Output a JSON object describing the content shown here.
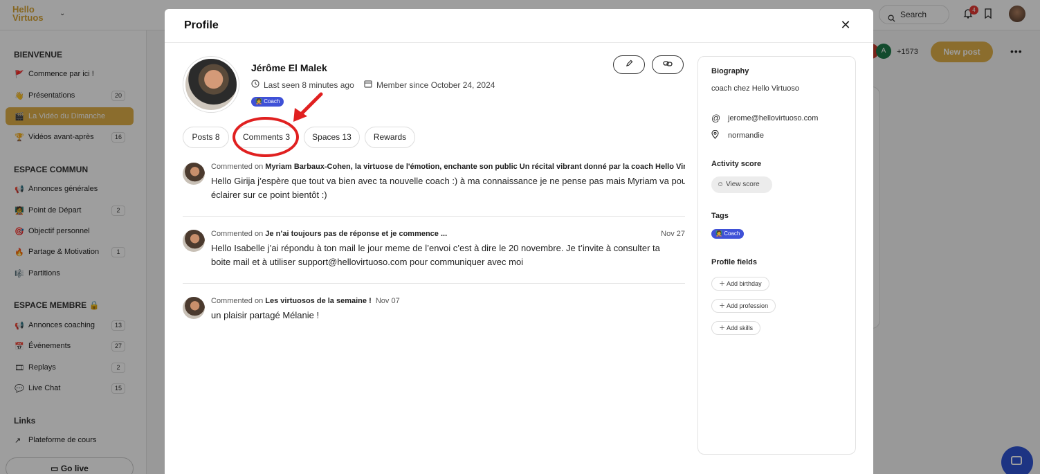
{
  "app": {
    "logo_line1": "Hello",
    "logo_line2": "Virtuos",
    "search_label": "Search",
    "notifications_count": "4"
  },
  "sidebar": {
    "sections": [
      {
        "title": "BIENVENUE"
      },
      {
        "title": "ESPACE COMMUN"
      },
      {
        "title": "ESPACE MEMBRE 🔒"
      },
      {
        "title": "Links"
      }
    ],
    "items": [
      {
        "emoji": "🚩",
        "label": "Commence par ici !",
        "count": ""
      },
      {
        "emoji": "👋",
        "label": "Présentations",
        "count": "20"
      },
      {
        "emoji": "🎬",
        "label": "La Vidéo du Dimanche",
        "count": ""
      },
      {
        "emoji": "🏆",
        "label": "Vidéos avant-après",
        "count": "16"
      },
      {
        "emoji": "📢",
        "label": "Annonces générales",
        "count": ""
      },
      {
        "emoji": "🧑‍🏫",
        "label": "Point de Départ",
        "count": "2"
      },
      {
        "emoji": "🎯",
        "label": "Objectif personnel",
        "count": ""
      },
      {
        "emoji": "🔥",
        "label": "Partage & Motivation",
        "count": "1"
      },
      {
        "emoji": "🎼",
        "label": "Partitions",
        "count": ""
      },
      {
        "emoji": "📢",
        "label": "Annonces coaching",
        "count": "13"
      },
      {
        "emoji": "📅",
        "label": "Événements",
        "count": "27"
      },
      {
        "emoji": "🎞",
        "label": "Replays",
        "count": "2"
      },
      {
        "emoji": "💬",
        "label": "Live Chat",
        "count": "15"
      },
      {
        "emoji": "↗",
        "label": "Plateforme de cours",
        "count": ""
      }
    ],
    "go_live": "Go live"
  },
  "feed": {
    "member_count": "+1573",
    "new_post": "New post",
    "avatar_letter": "A"
  },
  "modal": {
    "title": "Profile",
    "name": "Jérôme El Malek",
    "last_seen": "Last seen 8 minutes ago",
    "member_since": "Member since October 24, 2024",
    "badge": "Coach",
    "tabs": [
      {
        "label": "Posts 8"
      },
      {
        "label": "Comments 3"
      },
      {
        "label": "Spaces 13"
      },
      {
        "label": "Rewards"
      }
    ],
    "comments": [
      {
        "prefix": "Commented on",
        "target": "Myriam Barbaux-Cohen, la virtuose de l'émotion, enchante son public Un récital vibrant donné par la coach Hello Virtuoso",
        "date": "",
        "text_line1": "Hello Girija j’espère que tout va bien avec ta nouvelle coach :) à ma connaissance je ne pense pas mais Myriam va pouvoir",
        "text_line2": "éclairer sur ce point bientôt :)"
      },
      {
        "prefix": "Commented on",
        "target": "Je n’ai toujours pas de réponse et je commence ...",
        "date": "Nov 27",
        "text_line1": "Hello Isabelle j’ai répondu à ton mail le jour meme de l’envoi c’est à dire le 20 novembre. Je t’invite à consulter ta",
        "text_line2": "boite mail et à utiliser support@hellovirtuoso.com pour communiquer avec moi"
      },
      {
        "prefix": "Commented on",
        "target": "Les virtuosos de la semaine !",
        "date": "Nov 07",
        "text_line1": "un plaisir partagé Mélanie !",
        "text_line2": ""
      }
    ],
    "panel": {
      "biography_title": "Biography",
      "biography_text": "coach chez Hello Virtuoso",
      "email": "jerome@hellovirtuoso.com",
      "location": "normandie",
      "activity_title": "Activity score",
      "view_score": "View score",
      "tags_title": "Tags",
      "tag": "Coach",
      "fields_title": "Profile fields",
      "add_birthday": "Add birthday",
      "add_profession": "Add profession",
      "add_skills": "Add skills"
    }
  },
  "colors": {
    "accent": "#e0b14a",
    "badge": "#3f51d7",
    "annotation": "#e02020"
  }
}
